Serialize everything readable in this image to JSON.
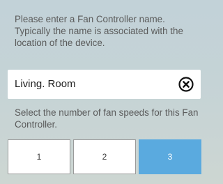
{
  "name_section": {
    "instruction": "Please enter a Fan Controller name. Typically the name is associated with the location of the device.",
    "input_value": "Living. Room",
    "clear_icon": "close-circle-icon"
  },
  "speed_section": {
    "instruction": "Select the number of fan speeds for this Fan Controller.",
    "options": [
      {
        "label": "1",
        "selected": false
      },
      {
        "label": "2",
        "selected": false
      },
      {
        "label": "3",
        "selected": true
      }
    ],
    "selected_color": "#5aaadf"
  }
}
